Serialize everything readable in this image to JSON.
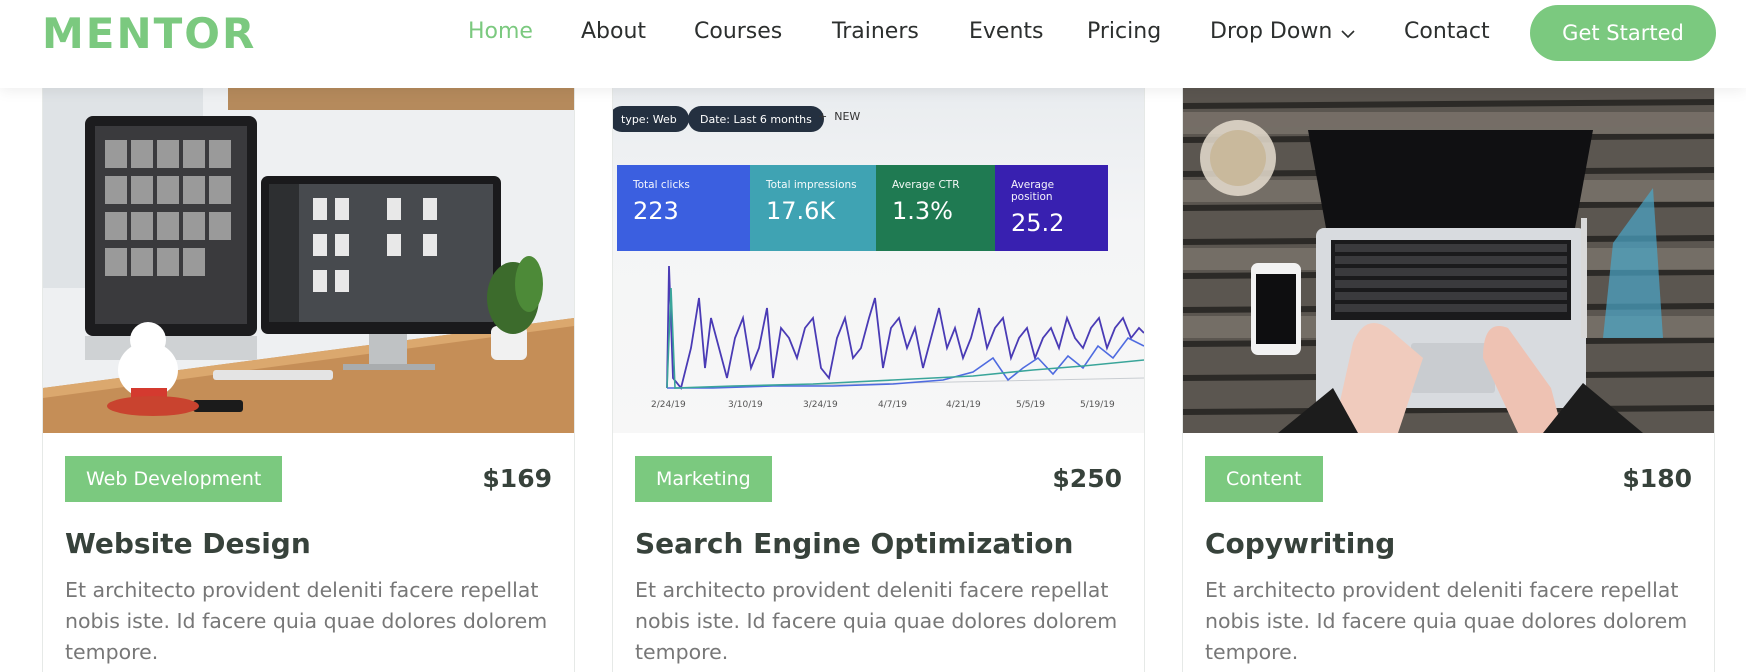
{
  "header": {
    "logo": "MENTOR",
    "nav": [
      {
        "label": "Home",
        "active": true
      },
      {
        "label": "About",
        "active": false
      },
      {
        "label": "Courses",
        "active": false
      },
      {
        "label": "Trainers",
        "active": false
      },
      {
        "label": "Events",
        "active": false
      },
      {
        "label": "Pricing",
        "active": false
      },
      {
        "label": "Drop Down",
        "active": false,
        "has_dropdown": true
      },
      {
        "label": "Contact",
        "active": false
      }
    ],
    "cta_label": "Get Started"
  },
  "colors": {
    "accent": "#7bc97f",
    "heading": "#37423b",
    "body_text": "#777777"
  },
  "courses": [
    {
      "category": "Web Development",
      "price": "$169",
      "title": "Website Design",
      "description": "Et architecto provident deleniti facere repellat nobis iste. Id facere quia quae dolores dolorem tempore.",
      "image": "desk-with-monitors-photo"
    },
    {
      "category": "Marketing",
      "price": "$250",
      "title": "Search Engine Optimization",
      "description": "Et architecto provident deleniti facere repellat nobis iste. Id facere quia quae dolores dolorem tempore.",
      "image": "analytics-dashboard-photo",
      "dashboard": {
        "chips": [
          "type: Web",
          "Date: Last 6 months"
        ],
        "new_label": "NEW",
        "metrics": [
          {
            "label": "Total clicks",
            "value": "223",
            "color": "#3b5fe0"
          },
          {
            "label": "Total impressions",
            "value": "17.6K",
            "color": "#3fa3b3"
          },
          {
            "label": "Average CTR",
            "value": "1.3%",
            "color": "#1f7a52"
          },
          {
            "label": "Average position",
            "value": "25.2",
            "color": "#3820b0"
          }
        ],
        "x_ticks": [
          "2/24/19",
          "3/10/19",
          "3/24/19",
          "4/7/19",
          "4/21/19",
          "5/5/19",
          "5/19/19"
        ]
      }
    },
    {
      "category": "Content",
      "price": "$180",
      "title": "Copywriting",
      "description": "Et architecto provident deleniti facere repellat nobis iste. Id facere quia quae dolores dolorem tempore.",
      "image": "laptop-typing-photo"
    }
  ]
}
